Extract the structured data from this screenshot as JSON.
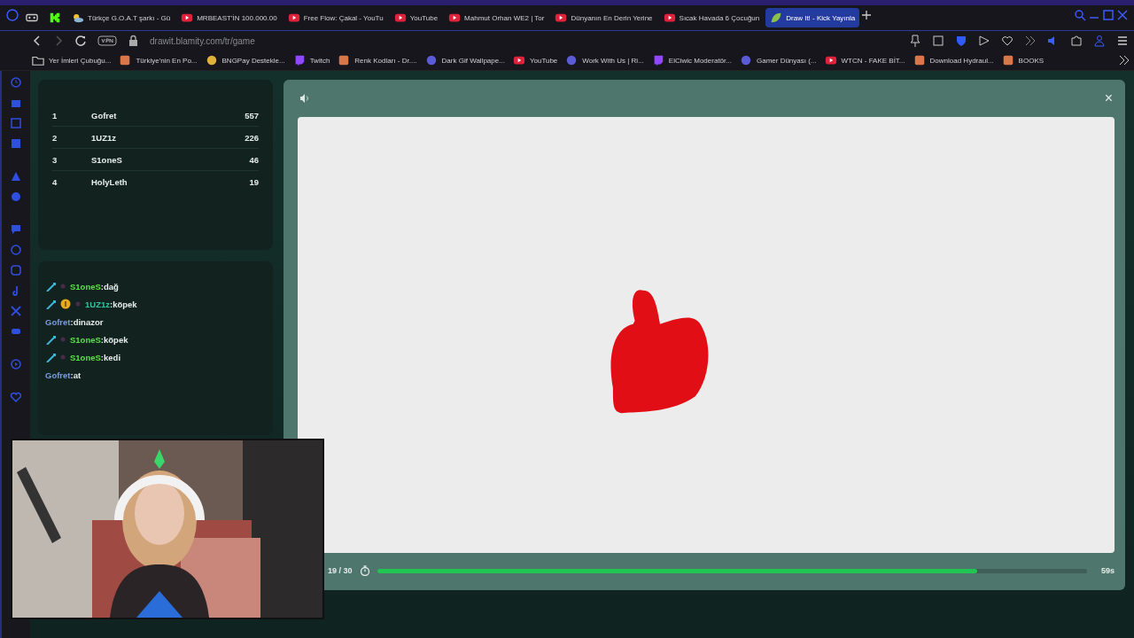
{
  "browser": {
    "tabs": [
      {
        "kind": "game",
        "selected": false
      },
      {
        "kind": "kick",
        "selected": false
      },
      {
        "kind": "weather",
        "label": "Türkçe G.O.A.T şarkı - Gü",
        "selected": false
      },
      {
        "kind": "youtube",
        "label": "MRBEAST'İN 100.000.00",
        "selected": false
      },
      {
        "kind": "youtube",
        "label": "Free Flow: Çakal - YouTu",
        "selected": false
      },
      {
        "kind": "youtube",
        "label": "YouTube",
        "selected": false
      },
      {
        "kind": "youtube",
        "label": "Mahmut Orhan WE2 | Tor",
        "selected": false
      },
      {
        "kind": "youtube",
        "label": "Dünyanın En Derin Yerine",
        "selected": false
      },
      {
        "kind": "youtube",
        "label": "Sıcak Havada 6 Çocuğun",
        "selected": false
      },
      {
        "kind": "leaf",
        "label": "Draw It! - Kick Yayınla",
        "selected": true
      }
    ],
    "address": "drawit.blamity.com/tr/game",
    "bookmarks": [
      {
        "kind": "folder",
        "label": "Yer İmleri Çubuğu..."
      },
      {
        "kind": "square",
        "label": "Türkiye'nin En Po..."
      },
      {
        "kind": "coin",
        "label": "BNGPay Destekle..."
      },
      {
        "kind": "twitch",
        "label": "Twitch"
      },
      {
        "kind": "square",
        "label": "Renk Kodları - Dr...."
      },
      {
        "kind": "circle",
        "label": "Dark Gif Wallpape..."
      },
      {
        "kind": "youtube",
        "label": "YouTube"
      },
      {
        "kind": "circle",
        "label": "Work With Us | Ri..."
      },
      {
        "kind": "twitch",
        "label": "ElCiwic Moderatör..."
      },
      {
        "kind": "circle",
        "label": "Gamer Dünyası (..."
      },
      {
        "kind": "youtube",
        "label": "WTCN - FAKE BİT..."
      },
      {
        "kind": "square",
        "label": "Download Hydraul..."
      },
      {
        "kind": "square",
        "label": "BOOKS"
      }
    ]
  },
  "leaderboard": [
    {
      "rank": "1",
      "name": "Gofret",
      "score": "557"
    },
    {
      "rank": "2",
      "name": "1UZ1z",
      "score": "226"
    },
    {
      "rank": "3",
      "name": "S1oneS",
      "score": "46"
    },
    {
      "rank": "4",
      "name": "HolyLeth",
      "score": "19"
    }
  ],
  "chat": [
    {
      "kind": "sword",
      "user": "S1oneS",
      "color": "#5be04a",
      "message": ":dağ"
    },
    {
      "kind": "sword_coin",
      "user": "1UZ1z",
      "color": "#2ec8a0",
      "message": ":köpek"
    },
    {
      "kind": "plain",
      "user": "Gofret",
      "color": "#7a9ce0",
      "message": ":dinazor"
    },
    {
      "kind": "sword",
      "user": "S1oneS",
      "color": "#5be04a",
      "message": ":köpek"
    },
    {
      "kind": "sword",
      "user": "S1oneS",
      "color": "#5be04a",
      "message": ":kedi"
    },
    {
      "kind": "plain",
      "user": "Gofret",
      "color": "#7a9ce0",
      "message": ":at"
    }
  ],
  "game": {
    "round": "19 / 30",
    "timer": {
      "level": 0.845
    },
    "time_left": "59s",
    "close": "×"
  }
}
